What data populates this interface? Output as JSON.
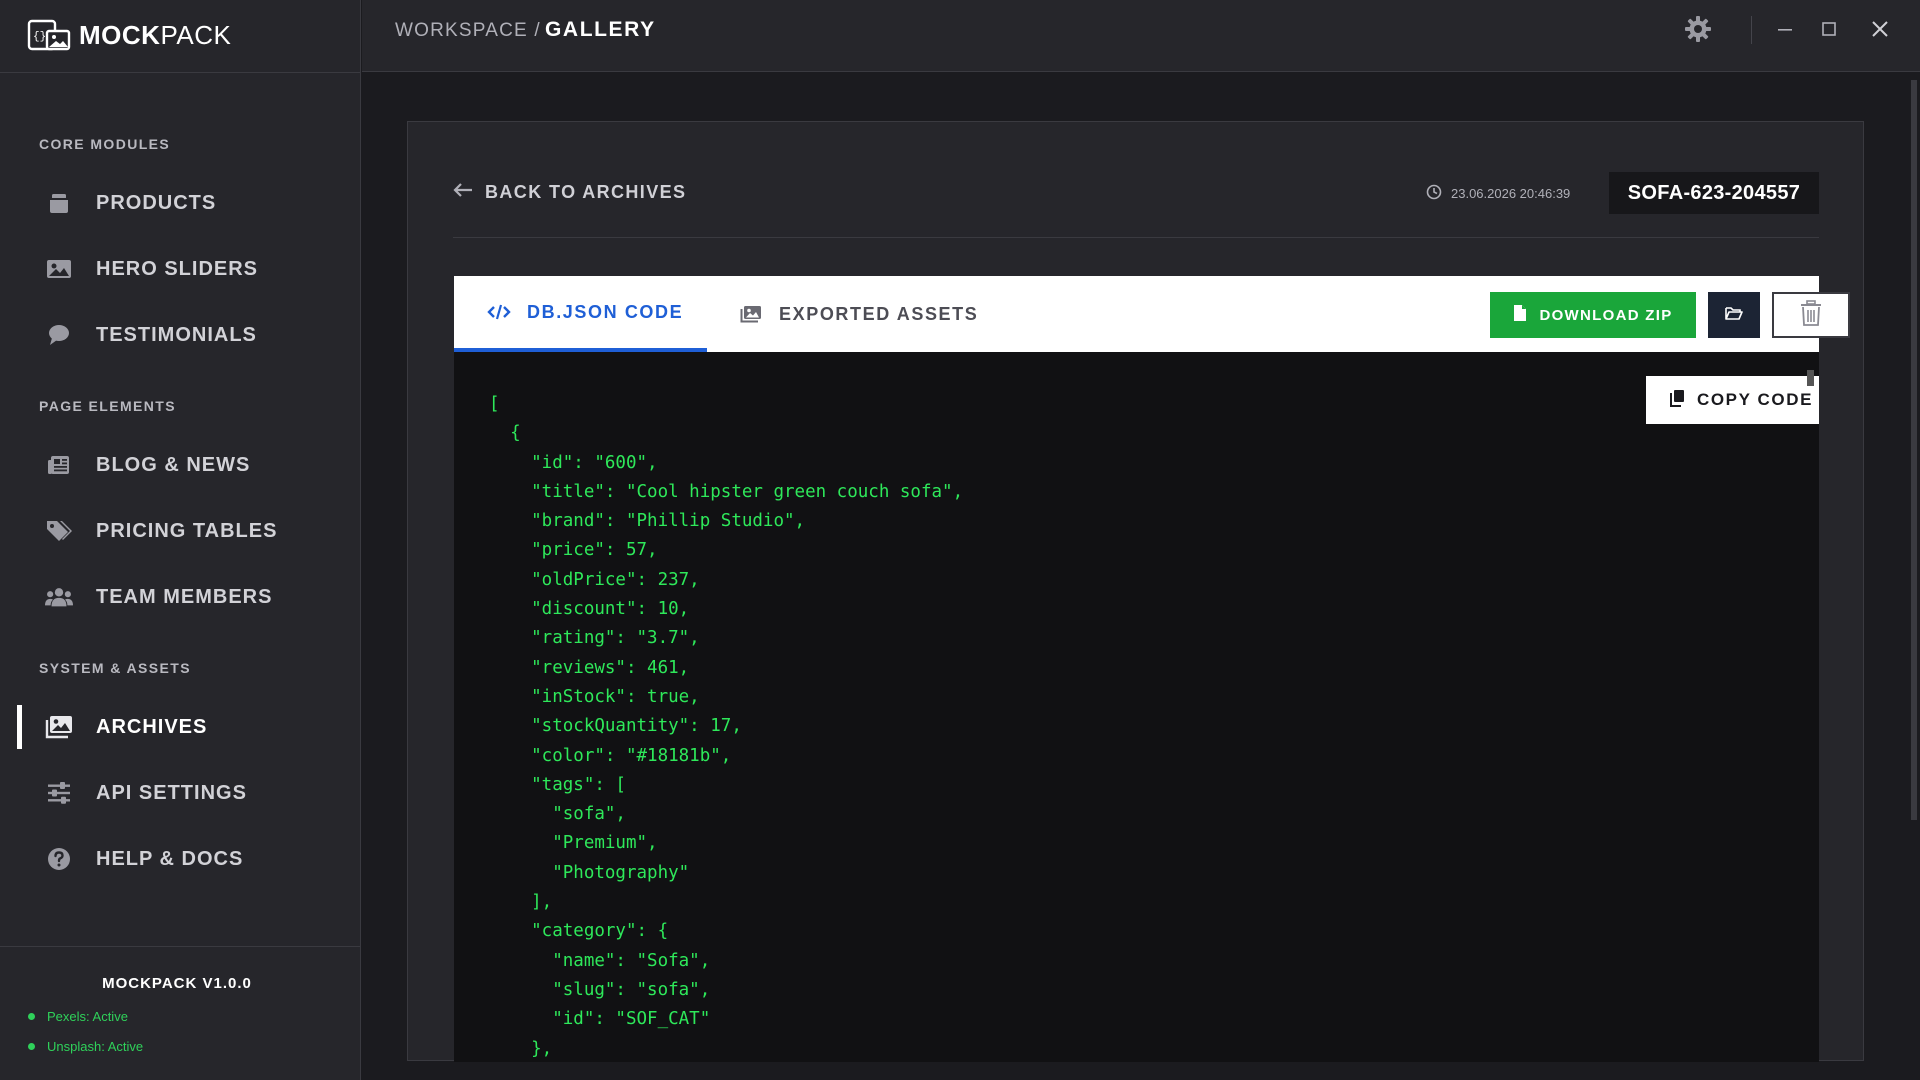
{
  "app": {
    "logo_text_bold": "MOCK",
    "logo_text_light": "PACK",
    "version": "MOCKPACK V1.0.0"
  },
  "sidebar": {
    "sections": [
      {
        "label": "CORE MODULES",
        "items": [
          {
            "label": "PRODUCTS",
            "icon": "box-icon"
          },
          {
            "label": "HERO SLIDERS",
            "icon": "image-icon"
          },
          {
            "label": "TESTIMONIALS",
            "icon": "chat-bubble-icon"
          }
        ]
      },
      {
        "label": "PAGE ELEMENTS",
        "items": [
          {
            "label": "BLOG & NEWS",
            "icon": "newspaper-icon"
          },
          {
            "label": "PRICING TABLES",
            "icon": "tags-icon"
          },
          {
            "label": "TEAM MEMBERS",
            "icon": "users-icon"
          }
        ]
      },
      {
        "label": "SYSTEM & ASSETS",
        "items": [
          {
            "label": "ARCHIVES",
            "icon": "images-icon",
            "active": true
          },
          {
            "label": "API SETTINGS",
            "icon": "sliders-icon"
          },
          {
            "label": "HELP & DOCS",
            "icon": "question-circle-icon"
          }
        ]
      }
    ],
    "status": [
      {
        "label": "Pexels: Active",
        "color": "#2fd15a"
      },
      {
        "label": "Unsplash: Active",
        "color": "#2fd15a"
      }
    ]
  },
  "topbar": {
    "breadcrumb_root": "WORKSPACE /",
    "breadcrumb_current": "GALLERY"
  },
  "detail": {
    "back_label": "BACK TO ARCHIVES",
    "timestamp": "23.06.2026 20:46:39",
    "record_id": "SOFA-623-204557",
    "tabs": [
      {
        "label": "DB.JSON CODE",
        "icon": "code-icon",
        "active": true
      },
      {
        "label": "EXPORTED ASSETS",
        "icon": "images-icon",
        "active": false
      }
    ],
    "download_label": "DOWNLOAD ZIP",
    "copy_label": "COPY CODE",
    "code_lines": [
      "[",
      "  {",
      "    \"id\": \"600\",",
      "    \"title\": \"Cool hipster green couch sofa\",",
      "    \"brand\": \"Phillip Studio\",",
      "    \"price\": 57,",
      "    \"oldPrice\": 237,",
      "    \"discount\": 10,",
      "    \"rating\": \"3.7\",",
      "    \"reviews\": 461,",
      "    \"inStock\": true,",
      "    \"stockQuantity\": 17,",
      "    \"color\": \"#18181b\",",
      "    \"tags\": [",
      "      \"sofa\",",
      "      \"Premium\",",
      "      \"Photography\"",
      "    ],",
      "    \"category\": {",
      "      \"name\": \"Sofa\",",
      "      \"slug\": \"sofa\",",
      "      \"id\": \"SOF_CAT\"",
      "    },"
    ]
  },
  "colors": {
    "accent_blue": "#1f5fd6",
    "download_green": "#1aa63a",
    "code_green": "#2ee85a",
    "status_green": "#2fd15a"
  }
}
